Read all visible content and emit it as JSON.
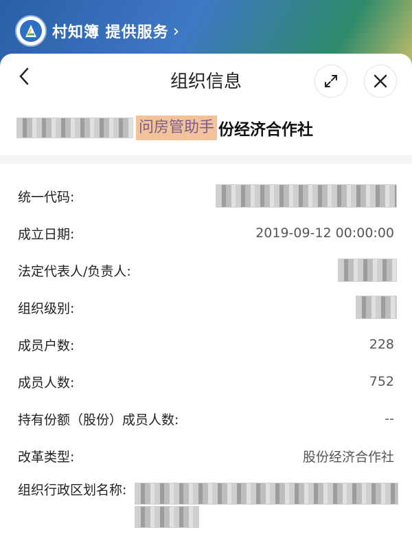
{
  "banner": {
    "brand_text": "村知簿 提供服务",
    "chevron": "›",
    "logo_icon": "village-book-logo"
  },
  "header": {
    "title": "组织信息",
    "back_icon": "chevron-left-icon",
    "expand_icon": "expand-icon",
    "close_icon": "close-icon"
  },
  "org": {
    "name_highlight": "问房管助手",
    "name_suffix": "份经济合作社"
  },
  "fields": {
    "code_label": "统一代码:",
    "date_label": "成立日期:",
    "date_value": "2019-09-12 00:00:00",
    "rep_label": "法定代表人/负责人:",
    "level_label": "组织级别:",
    "households_label": "成员户数:",
    "households_value": "228",
    "members_label": "成员人数:",
    "members_value": "752",
    "share_members_label": "持有份额（股份）成员人数:",
    "share_members_value": "--",
    "reform_label": "改革类型:",
    "reform_value": "股份经济合作社",
    "region_label": "组织行政区划名称:"
  }
}
